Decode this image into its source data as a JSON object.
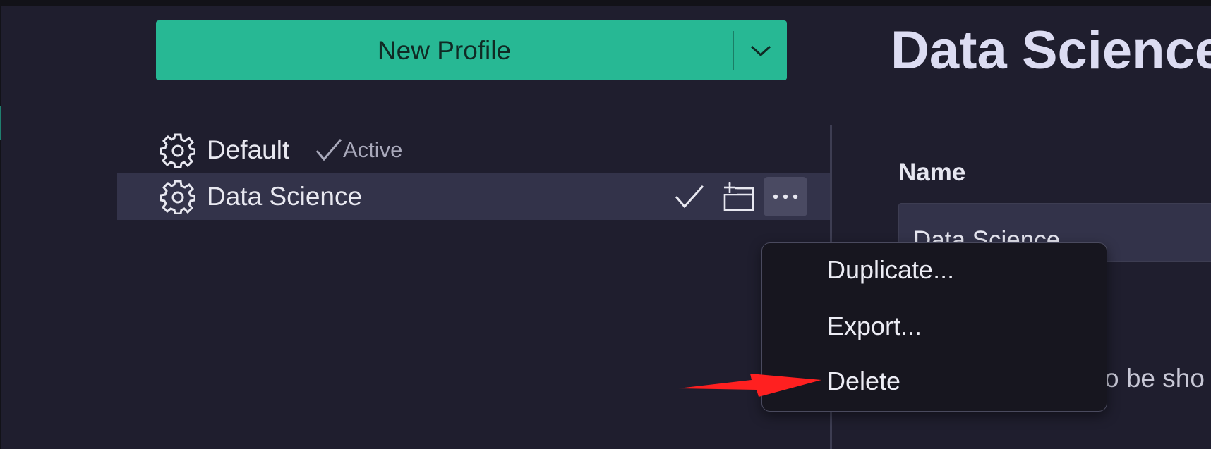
{
  "new_profile_button": {
    "label": "New Profile"
  },
  "profiles": [
    {
      "name": "Default",
      "status": "Active",
      "icon": "gear-icon"
    },
    {
      "name": "Data Science",
      "icon": "gear-icon",
      "actions": [
        "checkmark-icon",
        "new-window-icon",
        "more-options-icon"
      ]
    }
  ],
  "detail": {
    "title": "Data Science",
    "name_label": "Name",
    "name_value": "Data Science",
    "partial_text": "o be sho"
  },
  "context_menu": {
    "items": [
      "Duplicate...",
      "Export...",
      "Delete"
    ]
  },
  "colors": {
    "background": "#1f1e2e",
    "button_accent": "#27b894",
    "selected_row": "#33334a",
    "annotation_arrow": "#ff2020"
  }
}
